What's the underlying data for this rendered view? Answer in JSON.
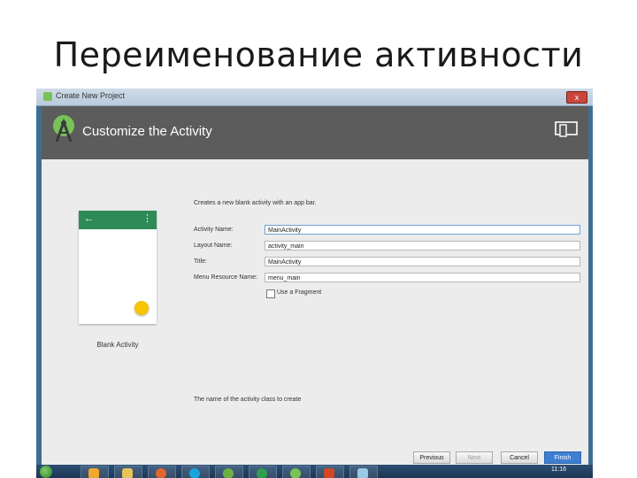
{
  "slide": {
    "title": "Переименование активности"
  },
  "window": {
    "title": "Create New Project",
    "close_label": "x"
  },
  "header": {
    "title": "Customize the Activity"
  },
  "preview": {
    "back_glyph": "←",
    "menu_glyph": "⋮",
    "caption": "Blank Activity"
  },
  "form": {
    "description": "Creates a new blank activity with an app bar.",
    "fields": [
      {
        "label": "Activity Name:",
        "value": "MainActivity"
      },
      {
        "label": "Layout Name:",
        "value": "activity_main"
      },
      {
        "label": "Title:",
        "value": "MainActivity"
      },
      {
        "label": "Menu Resource Name:",
        "value": "menu_main"
      }
    ],
    "fragment_label": "Use a Fragment",
    "fragment_checked": false,
    "hint": "The name of the activity class to create"
  },
  "buttons": {
    "previous": "Previous",
    "next": "Next",
    "cancel": "Cancel",
    "finish": "Finish"
  },
  "taskbar": {
    "icons": [
      "outlook-icon",
      "explorer-icon",
      "firefox-icon",
      "skype-icon",
      "utorrent-icon",
      "chrome-icon",
      "android-studio-icon",
      "powerpoint-icon",
      "paint-icon"
    ],
    "clock": "11:16"
  },
  "colors": {
    "header": "#5c5c5c",
    "accent_green": "#2e8b57",
    "fab": "#f7c400",
    "finish_button": "#3f7fd1"
  }
}
